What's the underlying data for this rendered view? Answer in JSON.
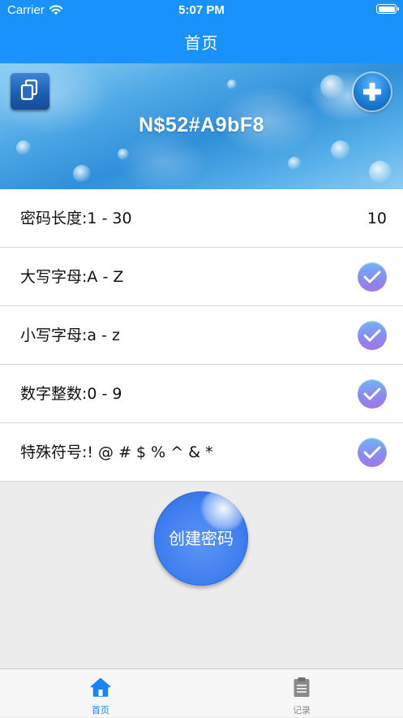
{
  "status_bar": {
    "carrier": "Carrier",
    "time": "5:07 PM"
  },
  "nav": {
    "title": "首页"
  },
  "banner": {
    "password": "N$52#A9bF8",
    "copy_icon": "copy-icon",
    "add_icon": "plus-icon"
  },
  "settings": {
    "length": {
      "label": "密码长度:1 - 30",
      "value": "10"
    },
    "uppercase": {
      "label": "大写字母:A - Z",
      "checked": true
    },
    "lowercase": {
      "label": "小写字母:a - z",
      "checked": true
    },
    "digits": {
      "label": "数字整数:0 - 9",
      "checked": true
    },
    "symbols": {
      "label": "特殊符号:! @ # $ % ^ & *",
      "checked": true
    }
  },
  "create_button": {
    "label": "创建密码"
  },
  "tabbar": {
    "tabs": [
      {
        "label": "首页",
        "icon": "home-icon",
        "active": true
      },
      {
        "label": "记录",
        "icon": "clipboard-icon",
        "active": false
      }
    ]
  },
  "colors": {
    "nav_blue": "#1a92fb",
    "active_tab": "#1a84f5",
    "create_button": "#4a86f2",
    "check_gradient_top": "#6fb4f3",
    "check_gradient_bottom": "#a276ea"
  }
}
